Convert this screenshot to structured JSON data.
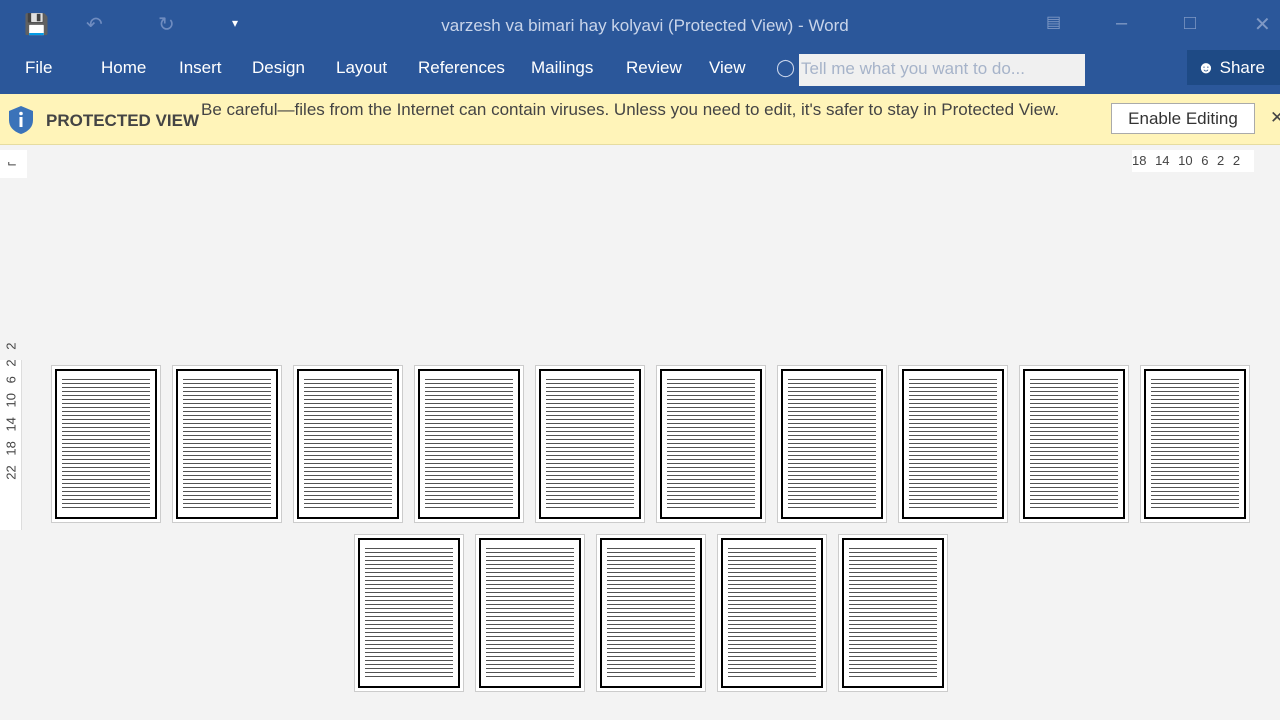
{
  "window": {
    "title": "varzesh va bimari hay kolyavi (Protected View) - Word"
  },
  "tabs": [
    "File",
    "Home",
    "Insert",
    "Design",
    "Layout",
    "References",
    "Mailings",
    "Review",
    "View"
  ],
  "tell_me": {
    "placeholder": "Tell me what you want to do..."
  },
  "share": "Share",
  "protected": {
    "label": "PROTECTED VIEW",
    "message": "Be careful—files from the Internet can contain viruses. Unless you need to edit, it's safer to stay in Protected View.",
    "enable": "Enable Editing"
  },
  "ruler": {
    "horizontal": "18 14 10 6 2 2",
    "vertical": "22 18 14 10 6 2 2"
  },
  "pages": {
    "count": 15,
    "row1": 10,
    "row2": 5
  },
  "colors": {
    "ribbon": "#2b579a",
    "banner": "#fff4b9"
  }
}
